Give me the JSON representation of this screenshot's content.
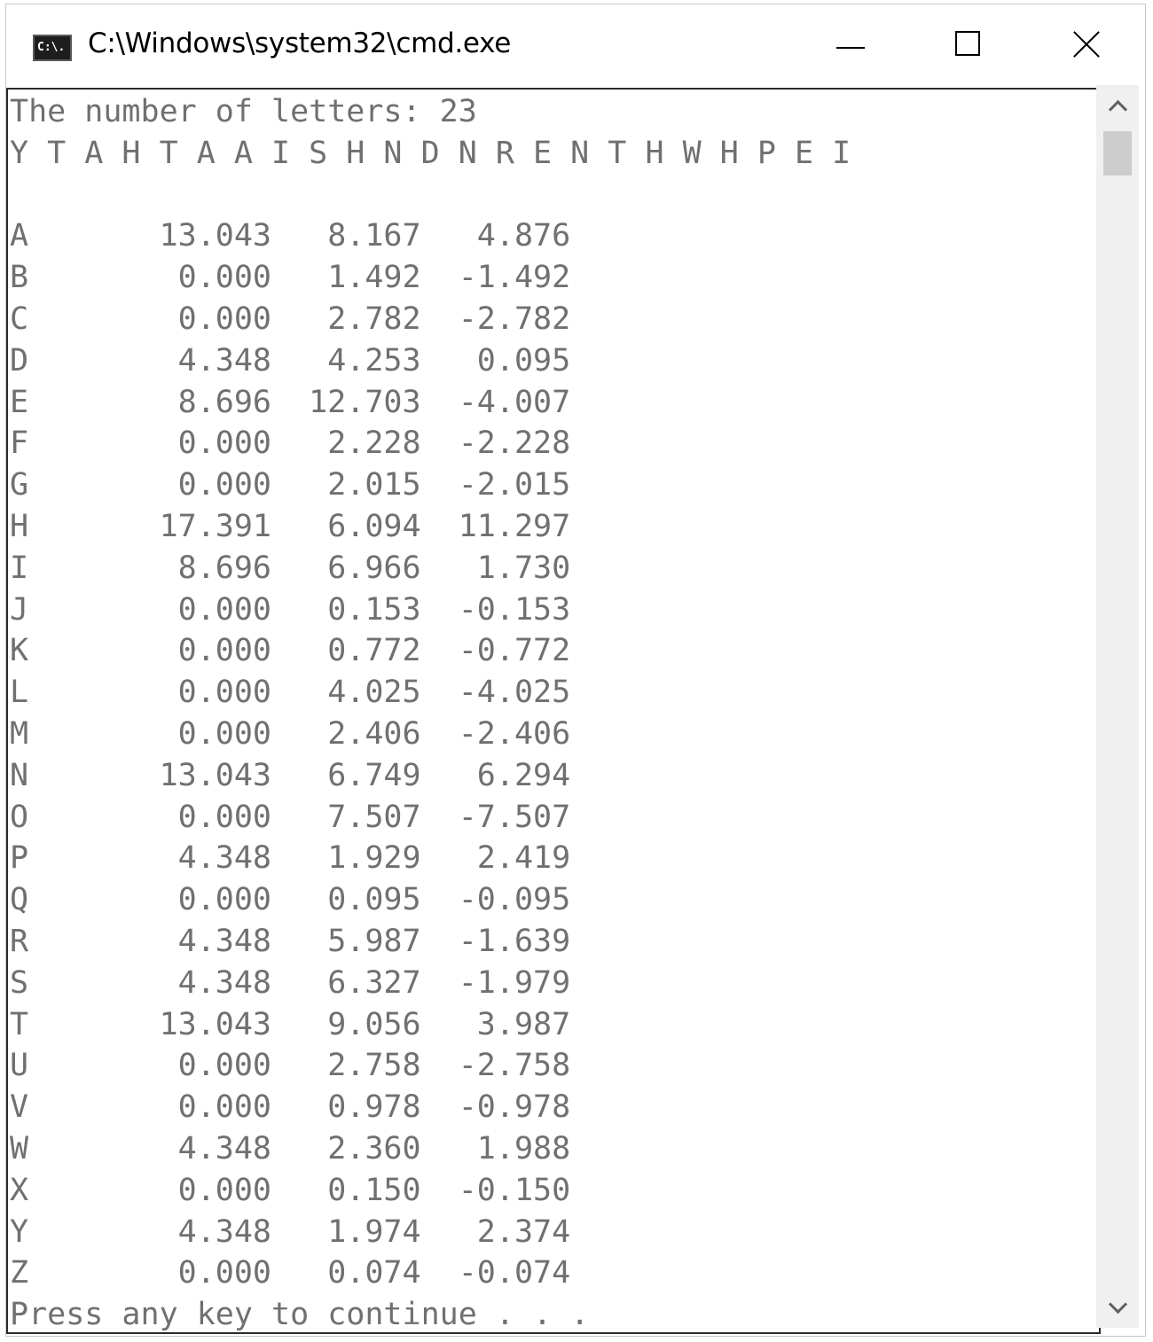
{
  "window": {
    "title": "C:\\Windows\\system32\\cmd.exe",
    "icon_text": "C:\\."
  },
  "console": {
    "lines": [
      "The number of letters: 23",
      "Y T A H T A A I S H N D N R E N T H W H P E I",
      "",
      "A       13.043   8.167   4.876",
      "B        0.000   1.492  -1.492",
      "C        0.000   2.782  -2.782",
      "D        4.348   4.253   0.095",
      "E        8.696  12.703  -4.007",
      "F        0.000   2.228  -2.228",
      "G        0.000   2.015  -2.015",
      "H       17.391   6.094  11.297",
      "I        8.696   6.966   1.730",
      "J        0.000   0.153  -0.153",
      "K        0.000   0.772  -0.772",
      "L        0.000   4.025  -4.025",
      "M        0.000   2.406  -2.406",
      "N       13.043   6.749   6.294",
      "O        0.000   7.507  -7.507",
      "P        4.348   1.929   2.419",
      "Q        0.000   0.095  -0.095",
      "R        4.348   5.987  -1.639",
      "S        4.348   6.327  -1.979",
      "T       13.043   9.056   3.987",
      "U        0.000   2.758  -2.758",
      "V        0.000   0.978  -0.978",
      "W        4.348   2.360   1.988",
      "X        0.000   0.150  -0.150",
      "Y        4.348   1.974   2.374",
      "Z        0.000   0.074  -0.074",
      "Press any key to continue . . ."
    ]
  },
  "colors": {
    "console_text": "#707070",
    "console_background": "#ffffff",
    "title_text": "#000000"
  },
  "icons": {
    "app": "cmd-icon",
    "minimize": "minimize-icon",
    "maximize": "maximize-icon",
    "close": "close-icon",
    "scroll_up": "chevron-up-icon",
    "scroll_down": "chevron-down-icon"
  }
}
